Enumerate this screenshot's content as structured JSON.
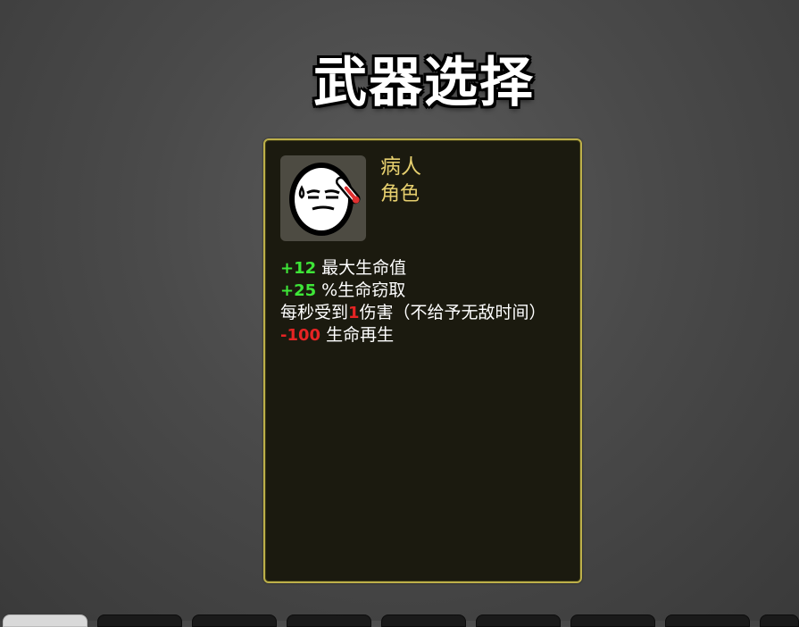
{
  "screen_title": "武器选择",
  "character": {
    "name": "病人",
    "type": "角色",
    "portrait_icon": "sick-egg-portrait-icon"
  },
  "stats": [
    {
      "value": "+12",
      "text": " 最大生命值",
      "color": "#3ee638"
    },
    {
      "value": "+25",
      "text": " %生命窃取",
      "color": "#3ee638"
    },
    {
      "prefix": "每秒受到",
      "value": "1",
      "suffix": "伤害（不给予无敌时间）",
      "color": "#e62424"
    },
    {
      "value": "-100",
      "text": " 生命再生",
      "color": "#e62424"
    }
  ],
  "colors": {
    "card_border": "#bdb04a",
    "card_bg": "#1b1a0f",
    "title_text": "#e6cf6e",
    "positive": "#3ee638",
    "negative": "#e62424"
  },
  "bottom_tabs": {
    "count": 9,
    "active_index": 0
  }
}
